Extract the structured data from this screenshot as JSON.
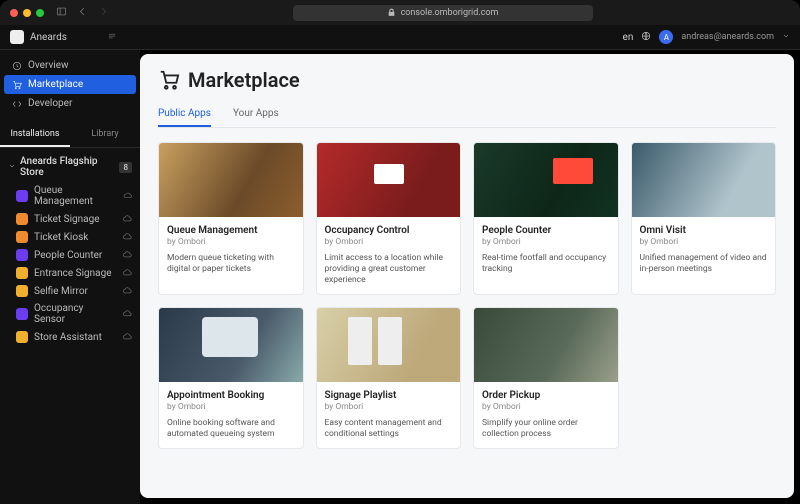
{
  "browser": {
    "url": "console.omborigrid.com"
  },
  "topbar": {
    "workspace": "Aneards",
    "lang": "en",
    "avatar_initial": "A",
    "email": "andreas@aneards.com"
  },
  "nav": {
    "overview": "Overview",
    "marketplace": "Marketplace",
    "developer": "Developer"
  },
  "side_tabs": {
    "installations": "Installations",
    "library": "Library"
  },
  "tree": {
    "root": "Aneards Flagship Store",
    "badge": "8",
    "items": [
      {
        "label": "Queue Management",
        "color": "#6a3df0"
      },
      {
        "label": "Ticket Signage",
        "color": "#f08a2e"
      },
      {
        "label": "Ticket Kiosk",
        "color": "#f08a2e"
      },
      {
        "label": "People Counter",
        "color": "#6a3df0"
      },
      {
        "label": "Entrance Signage",
        "color": "#f0b02e"
      },
      {
        "label": "Selfie Mirror",
        "color": "#f0b02e"
      },
      {
        "label": "Occupancy Sensor",
        "color": "#6a3df0"
      },
      {
        "label": "Store Assistant",
        "color": "#f0b02e"
      }
    ]
  },
  "page": {
    "title": "Marketplace",
    "tabs": {
      "public": "Public Apps",
      "yours": "Your Apps"
    }
  },
  "apps": [
    {
      "title": "Queue Management",
      "vendor": "by Ombori",
      "desc": "Modern queue ticketing with digital or paper tickets"
    },
    {
      "title": "Occupancy Control",
      "vendor": "by Ombori",
      "desc": "Limit access to a location while providing a great customer experience"
    },
    {
      "title": "People Counter",
      "vendor": "by Ombori",
      "desc": "Real-time footfall and occupancy tracking"
    },
    {
      "title": "Omni Visit",
      "vendor": "by Ombori",
      "desc": "Unified management of video and in-person meetings"
    },
    {
      "title": "Appointment Booking",
      "vendor": "by Ombori",
      "desc": "Online booking software and automated queueing system"
    },
    {
      "title": "Signage Playlist",
      "vendor": "by Ombori",
      "desc": "Easy content management and conditional settings"
    },
    {
      "title": "Order Pickup",
      "vendor": "by Ombori",
      "desc": "Simplify your online order collection process"
    }
  ]
}
